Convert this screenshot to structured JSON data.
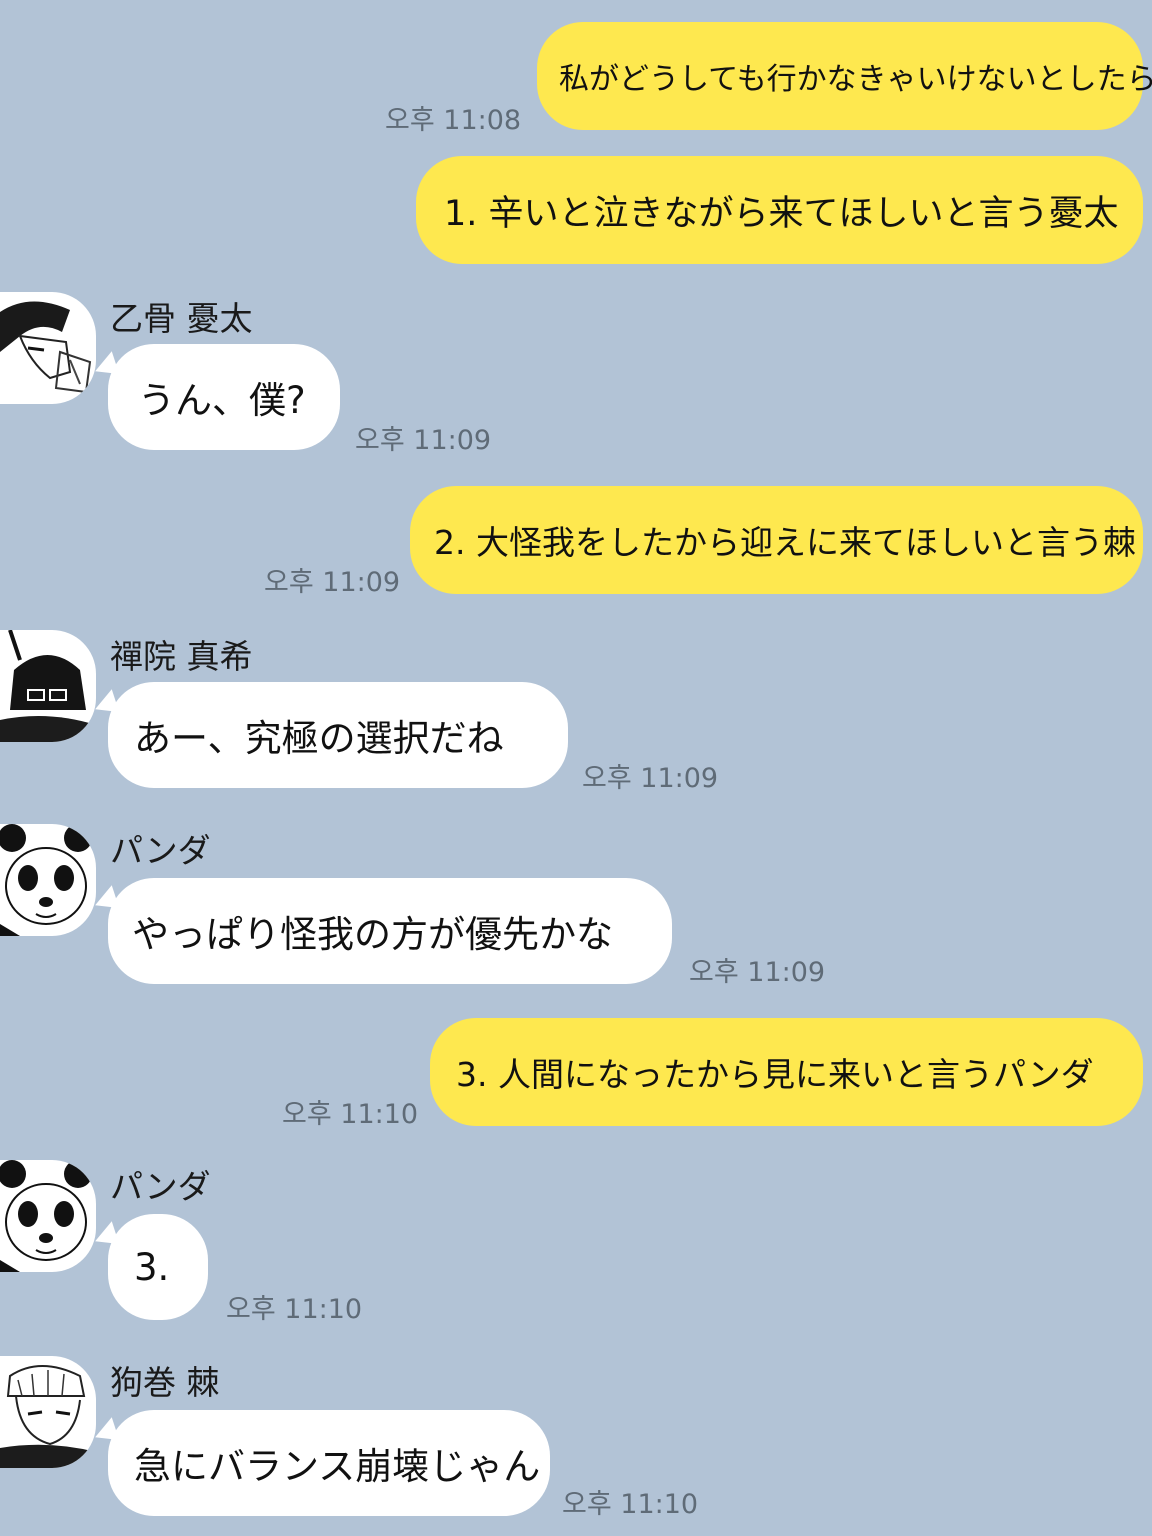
{
  "messages": [
    {
      "sender": "me",
      "text": "私がどうしても行かなきゃいけないとしたら?",
      "time": "오후 11:08"
    },
    {
      "sender": "me",
      "text": "1. 辛いと泣きながら来てほしいと言う憂太",
      "time": ""
    },
    {
      "sender": "乙骨 憂太",
      "avatar_icon": "yuta-avatar-icon",
      "text": "うん、僕?",
      "time": "오후 11:09"
    },
    {
      "sender": "me",
      "text": "2. 大怪我をしたから迎えに来てほしいと言う棘",
      "time": "오후 11:09"
    },
    {
      "sender": "禪院 真希",
      "avatar_icon": "maki-avatar-icon",
      "text": "あー、究極の選択だね",
      "time": "오후 11:09"
    },
    {
      "sender": "パンダ",
      "avatar_icon": "panda-avatar-icon",
      "text": "やっぱり怪我の方が優先かな",
      "time": "오후 11:09"
    },
    {
      "sender": "me",
      "text": "3. 人間になったから見に来いと言うパンダ",
      "time": "오후 11:10"
    },
    {
      "sender": "パンダ",
      "avatar_icon": "panda-avatar-icon",
      "text": "3.",
      "time": "오후 11:10"
    },
    {
      "sender": "狗巻 棘",
      "avatar_icon": "toge-avatar-icon",
      "text": "急にバランス崩壊じゃん",
      "time": "오후 11:10"
    }
  ],
  "colors": {
    "background": "#b2c3d6",
    "outgoing_bubble": "#fee84f",
    "incoming_bubble": "#ffffff",
    "time_text": "#5f6b77"
  }
}
